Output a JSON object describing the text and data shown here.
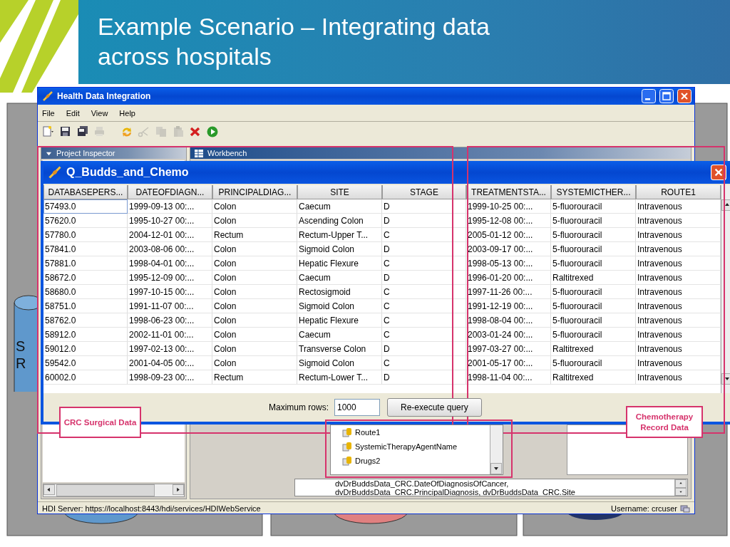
{
  "slide": {
    "title": "Example Scenario – Integrating data across hospitals",
    "fragments": [
      "S",
      "R"
    ]
  },
  "main_window": {
    "title": "Health Data Integration",
    "menu": [
      "File",
      "Edit",
      "View",
      "Help"
    ],
    "toolbar": [
      {
        "kind": "new",
        "disabled": false
      },
      {
        "kind": "save",
        "disabled": false
      },
      {
        "kind": "save-all",
        "disabled": false
      },
      {
        "kind": "print",
        "disabled": true
      },
      {
        "kind": "refresh",
        "disabled": false
      },
      {
        "kind": "cut",
        "disabled": true
      },
      {
        "kind": "copy",
        "disabled": true
      },
      {
        "kind": "paste",
        "disabled": true
      },
      {
        "kind": "delete",
        "disabled": false
      },
      {
        "kind": "run",
        "disabled": false
      }
    ],
    "project_inspector": "Project Inspector",
    "workbench": "Workbench",
    "tree_items": [
      "Route1",
      "SystemicTherapyAgentName",
      "Drugs2"
    ],
    "sql_lines": [
      "dvDrBuddsData_CRC.DateOfDiagnosisOfCancer,",
      "dvDrBuddsData_CRC.PrincipalDiagnosis, dvDrBuddsData_CRC.Site"
    ],
    "status_left": "HDI Server: https://localhost:8443/hdi/services/HDIWebService",
    "status_right": "Username: crcuser"
  },
  "query_window": {
    "title": "Q_Budds_and_Chemo",
    "columns": [
      "DATABASEPERS...",
      "DATEOFDIAGN...",
      "PRINCIPALDIAG...",
      "SITE",
      "STAGE",
      "TREATMENTSTA...",
      "SYSTEMICTHER...",
      "ROUTE1"
    ],
    "rows": [
      {
        "selected": true,
        "cells": [
          "57493.0",
          "1999-09-13 00:...",
          "Colon",
          "Caecum",
          "D",
          "1999-10-25 00:...",
          "5-fluorouracil",
          "Intravenous"
        ]
      },
      {
        "selected": false,
        "cells": [
          "57620.0",
          "1995-10-27 00:...",
          "Colon",
          "Ascending Colon",
          "D",
          "1995-12-08 00:...",
          "5-fluorouracil",
          "Intravenous"
        ]
      },
      {
        "selected": false,
        "cells": [
          "57780.0",
          "2004-12-01 00:...",
          "Rectum",
          "Rectum-Upper T...",
          "C",
          "2005-01-12 00:...",
          "5-fluorouracil",
          "Intravenous"
        ]
      },
      {
        "selected": false,
        "cells": [
          "57841.0",
          "2003-08-06 00:...",
          "Colon",
          "Sigmoid Colon",
          "D",
          "2003-09-17 00:...",
          "5-fluorouracil",
          "Intravenous"
        ]
      },
      {
        "selected": false,
        "cells": [
          "57881.0",
          "1998-04-01 00:...",
          "Colon",
          "Hepatic Flexure",
          "C",
          "1998-05-13 00:...",
          "5-fluorouracil",
          "Intravenous"
        ]
      },
      {
        "selected": false,
        "cells": [
          "58672.0",
          "1995-12-09 00:...",
          "Colon",
          "Caecum",
          "D",
          "1996-01-20 00:...",
          "Raltitrexed",
          "Intravenous"
        ]
      },
      {
        "selected": false,
        "cells": [
          "58680.0",
          "1997-10-15 00:...",
          "Colon",
          "Rectosigmoid",
          "C",
          "1997-11-26 00:...",
          "5-fluorouracil",
          "Intravenous"
        ]
      },
      {
        "selected": false,
        "cells": [
          "58751.0",
          "1991-11-07 00:...",
          "Colon",
          "Sigmoid Colon",
          "C",
          "1991-12-19 00:...",
          "5-fluorouracil",
          "Intravenous"
        ]
      },
      {
        "selected": false,
        "cells": [
          "58762.0",
          "1998-06-23 00:...",
          "Colon",
          "Hepatic Flexure",
          "C",
          "1998-08-04 00:...",
          "5-fluorouracil",
          "Intravenous"
        ]
      },
      {
        "selected": false,
        "cells": [
          "58912.0",
          "2002-11-01 00:...",
          "Colon",
          "Caecum",
          "C",
          "2003-01-24 00:...",
          "5-fluorouracil",
          "Intravenous"
        ]
      },
      {
        "selected": false,
        "cells": [
          "59012.0",
          "1997-02-13 00:...",
          "Colon",
          "Transverse Colon",
          "D",
          "1997-03-27 00:...",
          "Raltitrexed",
          "Intravenous"
        ]
      },
      {
        "selected": false,
        "cells": [
          "59542.0",
          "2001-04-05 00:...",
          "Colon",
          "Sigmoid Colon",
          "C",
          "2001-05-17 00:...",
          "5-fluorouracil",
          "Intravenous"
        ]
      },
      {
        "selected": false,
        "cells": [
          "60002.0",
          "1998-09-23 00:...",
          "Rectum",
          "Rectum-Lower T...",
          "D",
          "1998-11-04 00:...",
          "Raltitrexed",
          "Intravenous"
        ]
      }
    ],
    "max_rows_label": "Maximum rows:",
    "max_rows_value": "1000",
    "button": "Re-execute query"
  },
  "annotations": [
    "CRC Surgical Data",
    "Chemotherapy Record Data"
  ]
}
